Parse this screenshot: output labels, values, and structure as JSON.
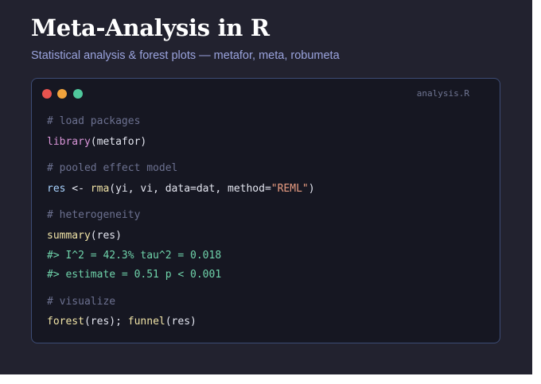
{
  "slide": {
    "title": "Meta-Analysis in R",
    "subtitle": "Statistical analysis & forest plots — metafor, meta, robumeta"
  },
  "editor": {
    "filename": "analysis.R",
    "window_buttons": [
      "close",
      "minimize",
      "maximize"
    ],
    "code": {
      "c1": "# load packages",
      "l1_fn": "library",
      "l1_args": "(metafor)",
      "c2": "# pooled effect model",
      "l2_var": "res",
      "l2_op": " <- ",
      "l2_fn": "rma",
      "l2_args": "(yi, vi, data=dat, method=",
      "l2_str": "\"REML\"",
      "l2_close": ")",
      "c3": "# heterogeneity",
      "l3_fn": "summary",
      "l3_args": "(res)",
      "o1": "#> I^2 = 42.3% tau^2 = 0.018",
      "o2": "#> estimate = 0.51 p < 0.001",
      "c4": "# visualize",
      "l4_fn1": "forest",
      "l4_args1": "(res); ",
      "l4_fn2": "funnel",
      "l4_args2": "(res)"
    }
  },
  "colors": {
    "background": "#22222f",
    "editor_bg": "#161722",
    "editor_border": "#3d4c75",
    "subtitle": "#9aa3dd",
    "comment": "#6c7190",
    "keyword": "#d995d8",
    "function": "#f0e3a6",
    "variable": "#a9d3ff",
    "string": "#ea9d82",
    "output": "#6fd3aa",
    "close_button": "#e8534f",
    "minimize_button": "#f1a33c",
    "maximize_button": "#4fc89c"
  }
}
